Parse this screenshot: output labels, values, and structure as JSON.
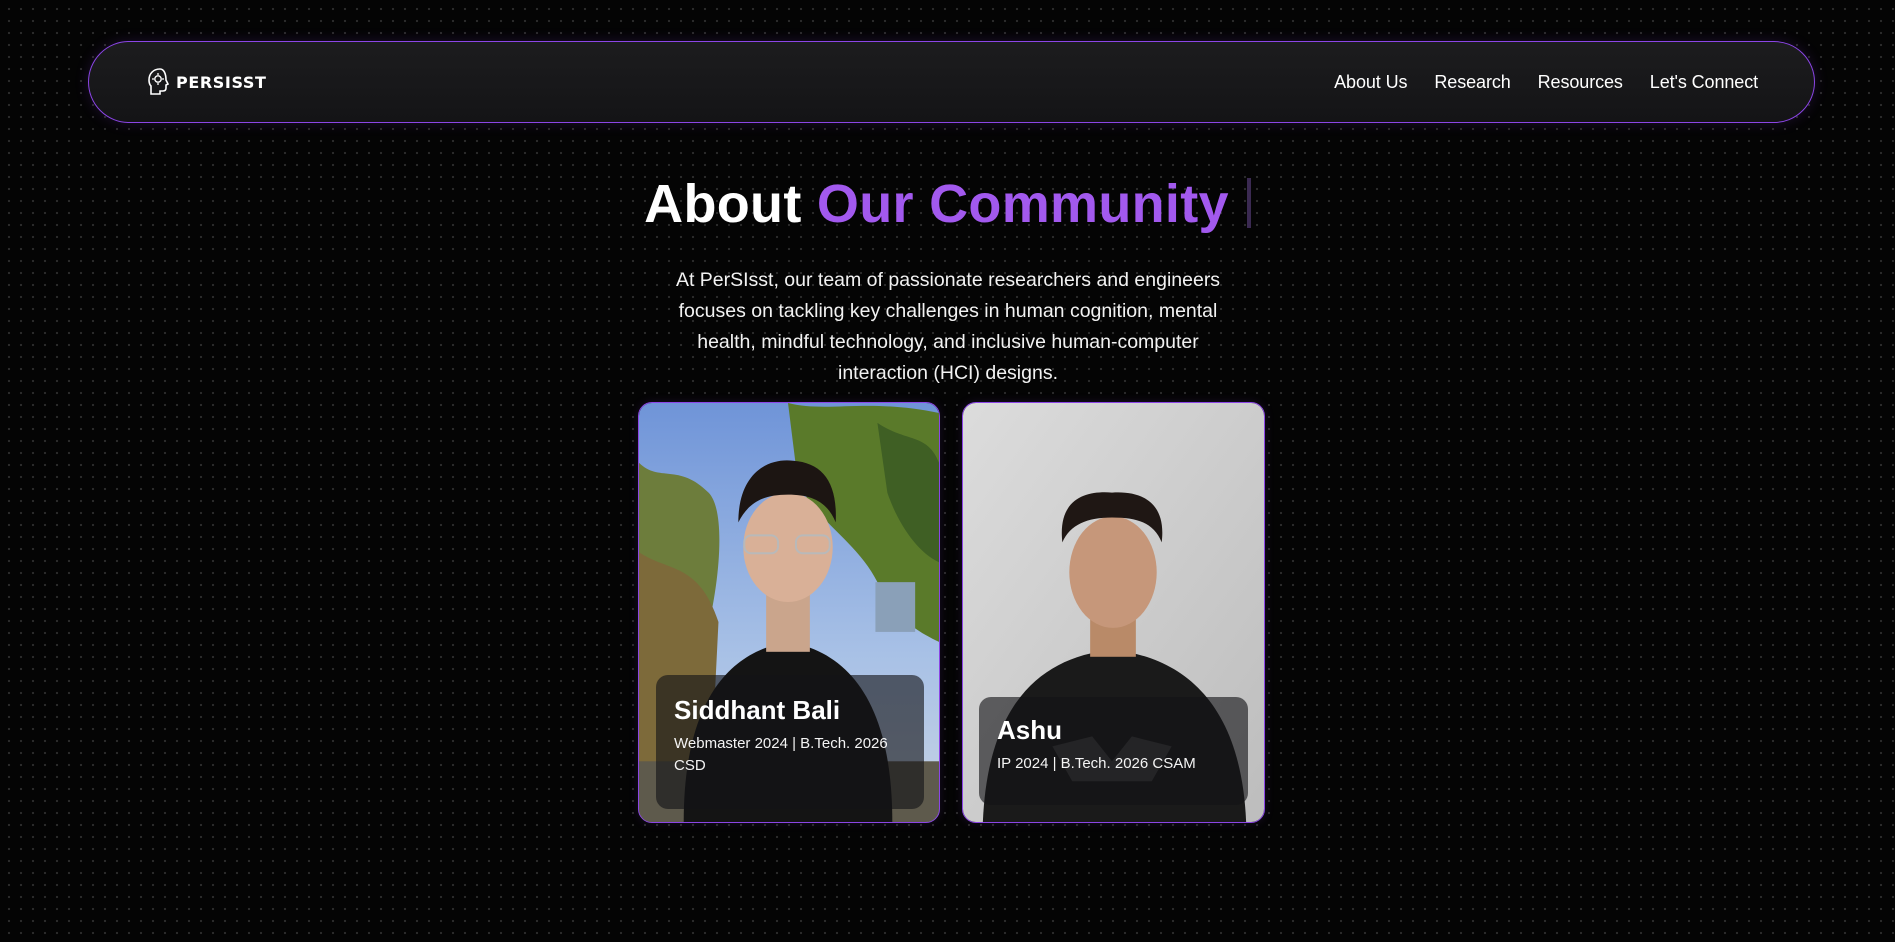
{
  "nav": {
    "brand": "PERSISST",
    "logo_icon": "head-profile-icon",
    "links": [
      "About Us",
      "Research",
      "Resources",
      "Let's Connect"
    ]
  },
  "hero": {
    "title_plain": "About",
    "title_accent": "Our Community",
    "accent_color": "#a259ee",
    "description": "At PerSIsst, our team of passionate researchers and engineers focuses on tackling key challenges in human cognition, mental health, mindful technology, and inclusive human-computer interaction (HCI) designs."
  },
  "members": [
    {
      "name": "Siddhant Bali",
      "role": "Webmaster 2024 | B.Tech. 2026 CSD"
    },
    {
      "name": "Ashu",
      "role": "IP 2024 | B.Tech. 2026 CSAM"
    }
  ],
  "colors": {
    "border": "#8b45e6",
    "background": "#040404"
  }
}
